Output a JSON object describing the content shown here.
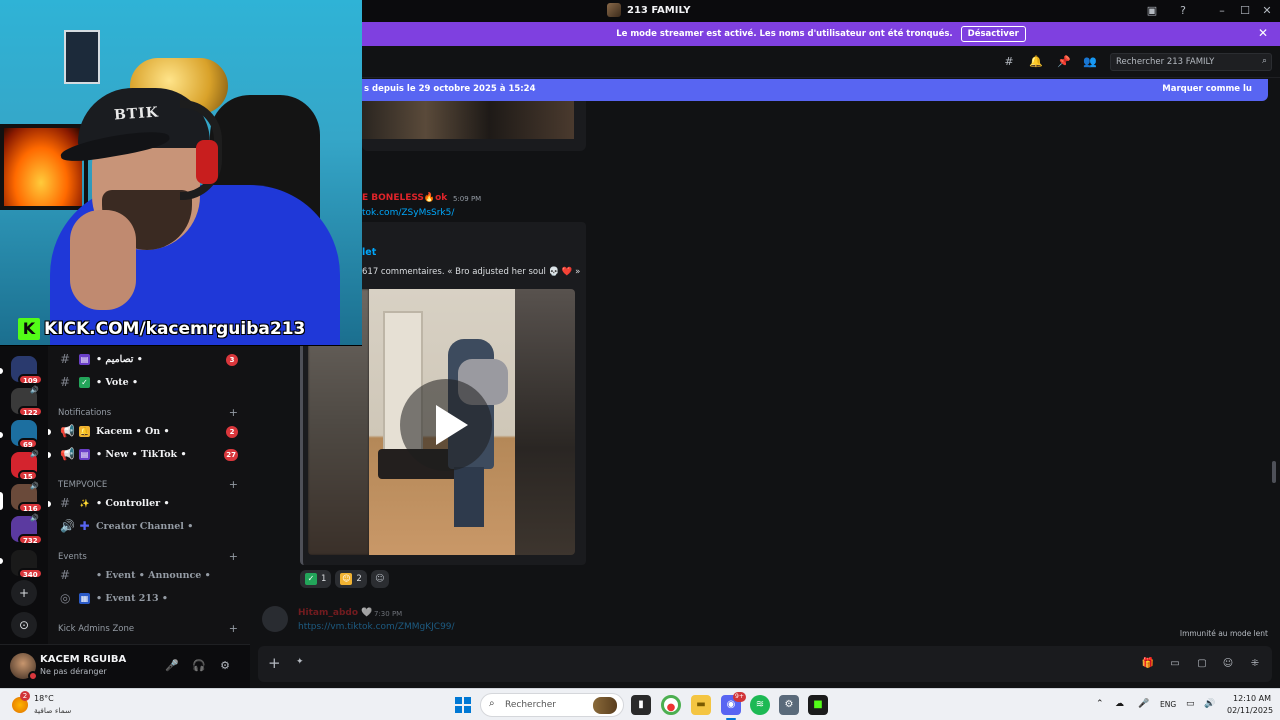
{
  "window": {
    "title": "213 FAMILY"
  },
  "banner": {
    "text": "Le mode streamer est activé. Les noms d'utilisateur ont été tronqués.",
    "button": "Désactiver"
  },
  "header": {
    "search_placeholder": "Rechercher 213 FAMILY"
  },
  "new_messages_bar": {
    "left_text": "s depuis le 29 octobre 2025 à 15:24",
    "mark_read": "Marquer comme lu"
  },
  "webcam": {
    "cap_text": "BTIK",
    "overlay_k": "K",
    "overlay_url": "KICK.COM/kacemrguiba213"
  },
  "servers": [
    {
      "badge": "109",
      "color": "#2a3a6e"
    },
    {
      "badge": "122",
      "color": "#3a3a3a"
    },
    {
      "badge": "69",
      "color": "#1c6fa0"
    },
    {
      "badge": "15",
      "color": "#d4242e"
    },
    {
      "badge": "116",
      "color": "#6a4a3a"
    },
    {
      "badge": "732",
      "color": "#5b3aa0"
    },
    {
      "badge": "340",
      "color": "#1a1a1a"
    }
  ],
  "channels": {
    "top": [
      {
        "name": "• تصاميم •",
        "count": "3",
        "emoji_color": "#6a3fc8"
      },
      {
        "name": "• Vote •",
        "count": "",
        "emoji_color": "#23a55a"
      }
    ],
    "cat_notifications": "Notifications",
    "notifications": [
      {
        "name": "Kacem • On •",
        "count": "2",
        "emoji_color": "#f0b232"
      },
      {
        "name": "• New • TikTok •",
        "count": "27",
        "emoji_color": "#6a3fc8"
      }
    ],
    "cat_tempvoice": "TEMPVOICE",
    "tempvoice": [
      {
        "name": "• Controller •",
        "emoji_color": "#f0b232"
      },
      {
        "name": "Creator Channel •",
        "emoji_color": "#5865f2"
      }
    ],
    "cat_events": "Events",
    "events": [
      {
        "name": "• Event • Announce •"
      },
      {
        "name": "• Event 213 •",
        "emoji_color": "#2a5ac8"
      }
    ],
    "cat_kick": "Kick Admins Zone"
  },
  "user": {
    "name": "KACEM RGUIBA",
    "status": "Ne pas déranger"
  },
  "messages": {
    "author1": "E BONELESS🔥ok",
    "time1": "5:09 PM",
    "link1": "tok.com/ZSyMsSrk5/",
    "embed_title": "let",
    "embed_desc": "617 commentaires. « Bro adjusted her soul 💀 ❤️ »",
    "reactions": [
      {
        "emoji": "✓",
        "count": "1",
        "color": "#23a55a"
      },
      {
        "emoji": "☺",
        "count": "2",
        "color": "#f0b232"
      }
    ],
    "author2": "Hitam_abdo 🤍",
    "time2": "7:30 PM",
    "link2": "https://vm.tiktok.com/ZMMgKJC99/",
    "immunity": "Immunité au mode lent"
  },
  "taskbar": {
    "weather_badge": "2",
    "weather_temp": "18°C",
    "weather_desc": "سماء صافية",
    "search_placeholder": "Rechercher",
    "discord_badge": "9+",
    "lang": "ENG",
    "time": "12:10 AM",
    "date": "02/11/2025"
  }
}
